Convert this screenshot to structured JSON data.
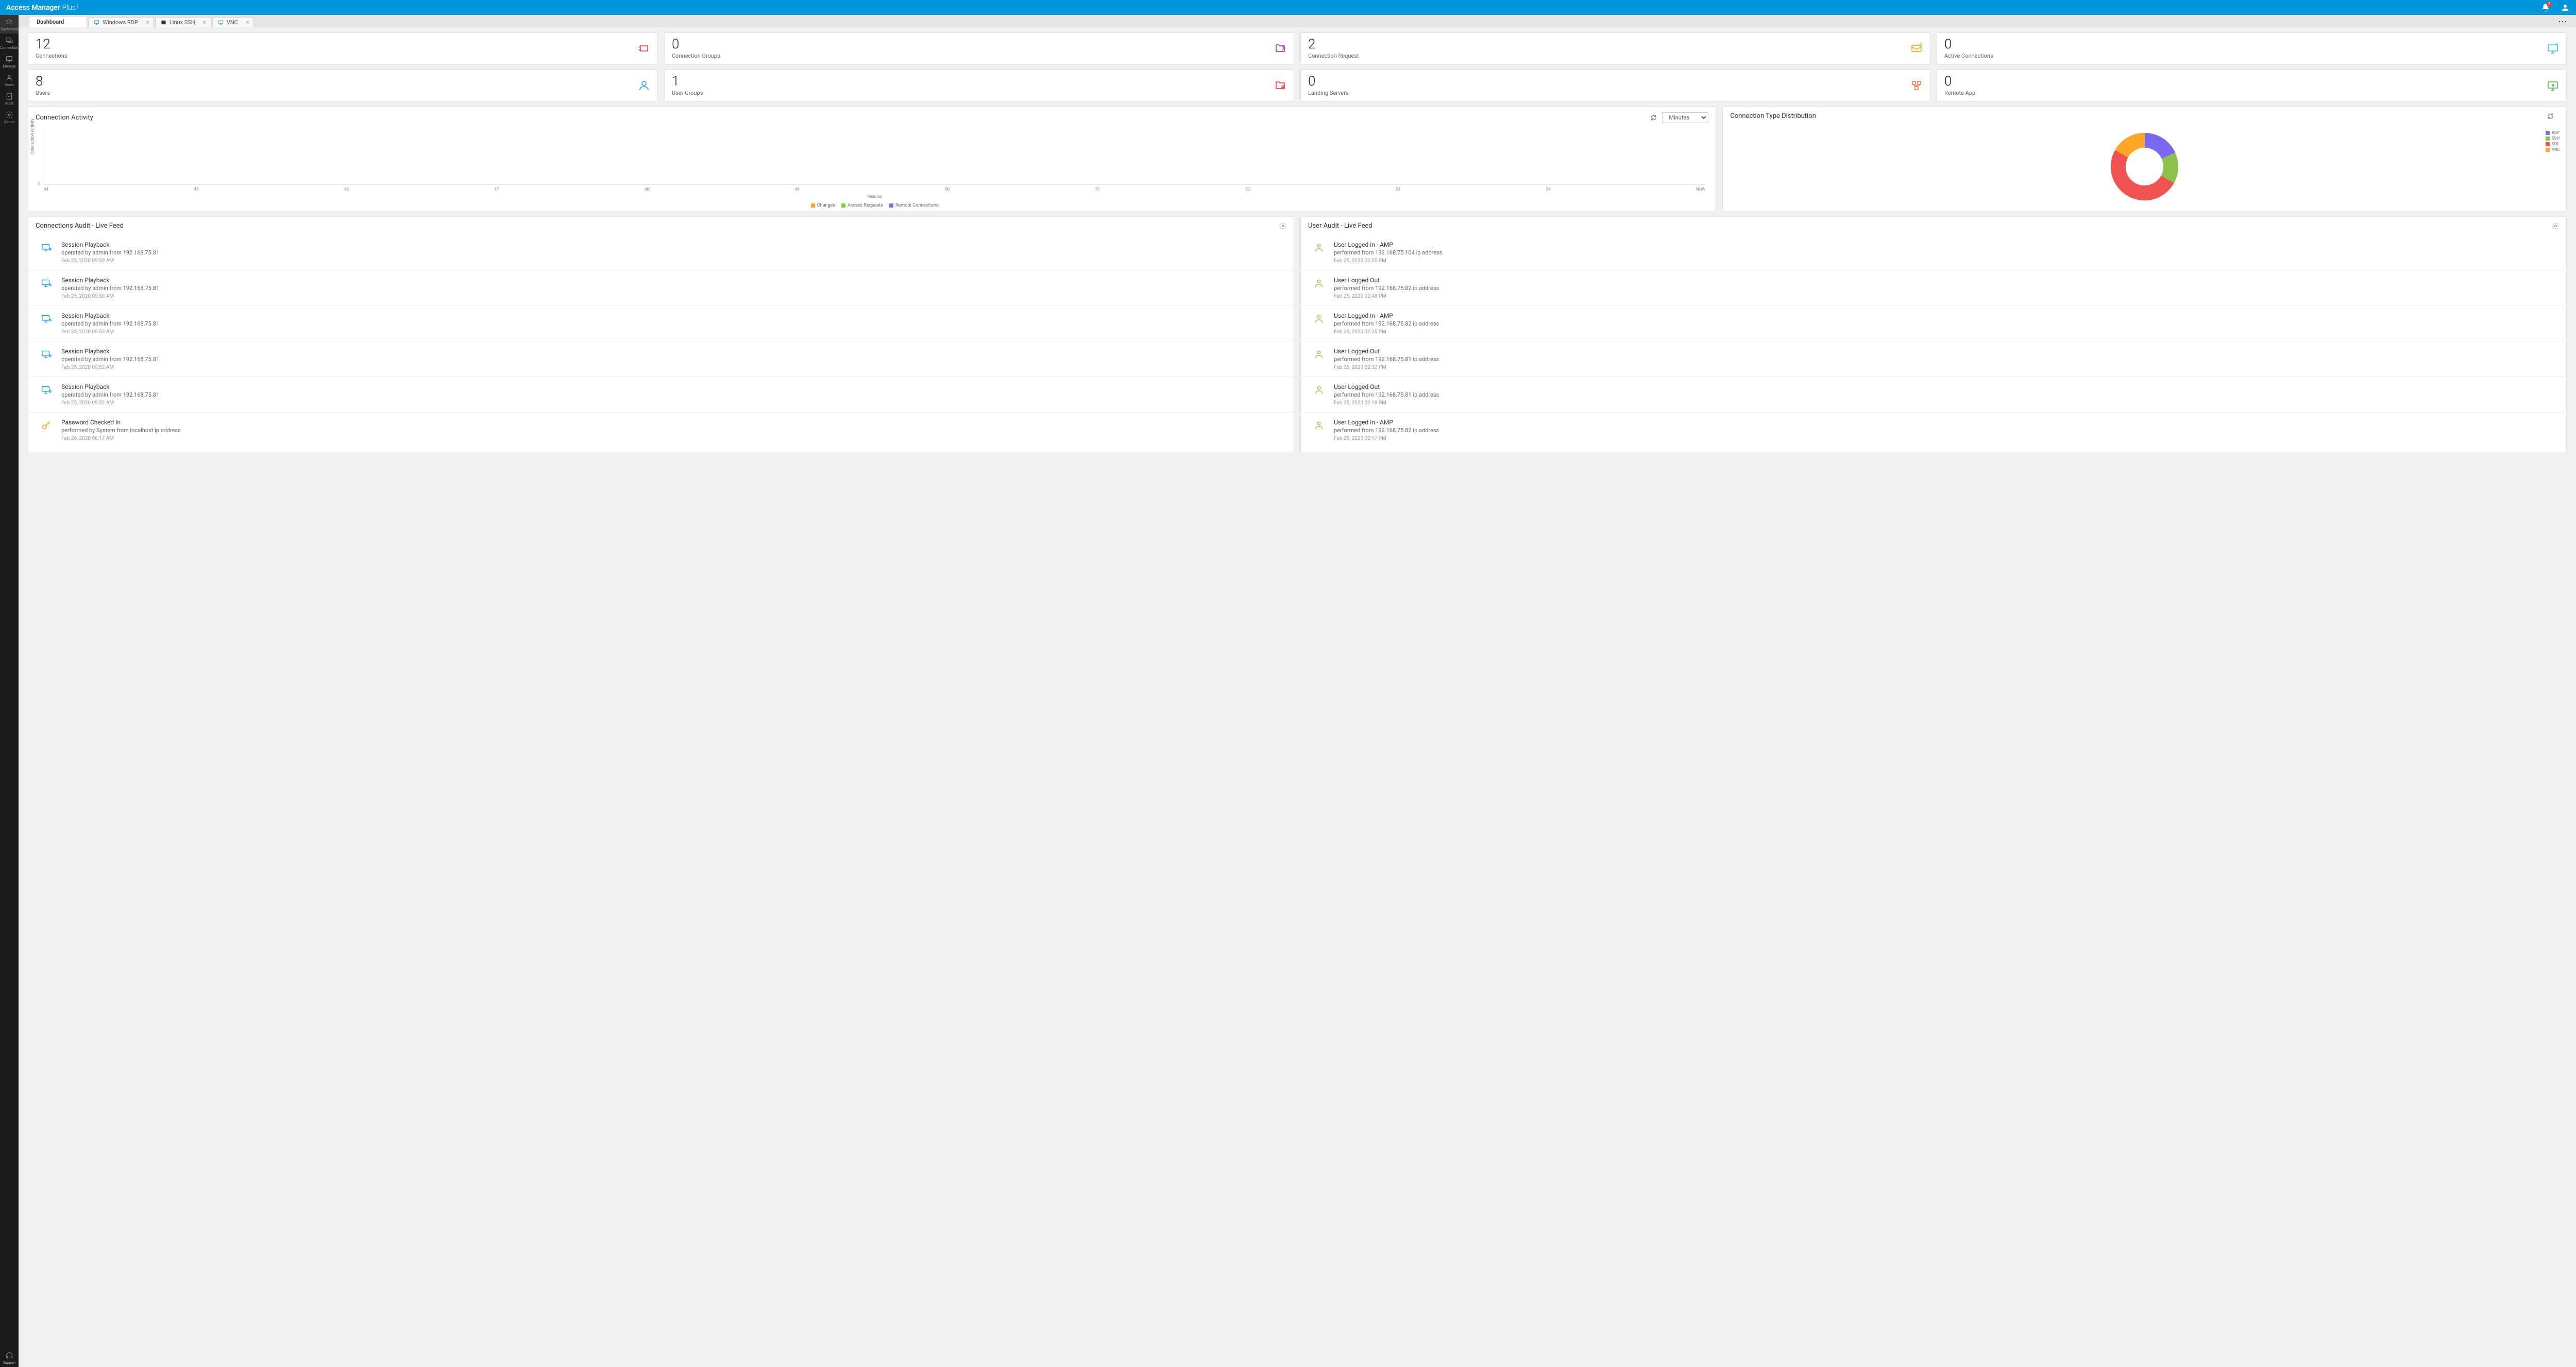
{
  "brand": {
    "main": "Access Manager",
    "sub": "Plus",
    "sup": ")"
  },
  "notif": "2",
  "sidebar": [
    {
      "label": "Dashboard",
      "on": true
    },
    {
      "label": "Connections"
    },
    {
      "label": "Manage"
    },
    {
      "label": "Users"
    },
    {
      "label": "Audit"
    },
    {
      "label": "Admin"
    }
  ],
  "sidebar_bottom": {
    "label": "Support"
  },
  "tabs": [
    {
      "label": "Dashboard",
      "on": true
    },
    {
      "label": "Windows RDP"
    },
    {
      "label": "Linux SSH"
    },
    {
      "label": "VNC"
    }
  ],
  "cards": [
    {
      "value": "12",
      "label": "Connections",
      "color": "#e53935"
    },
    {
      "value": "0",
      "label": "Connection Groups",
      "color": "#9c27b0"
    },
    {
      "value": "2",
      "label": "Connection Request",
      "color": "#ff9800"
    },
    {
      "value": "0",
      "label": "Active Connections",
      "color": "#26c6da"
    },
    {
      "value": "8",
      "label": "Users",
      "color": "#2196f3"
    },
    {
      "value": "1",
      "label": "User Groups",
      "color": "#e53935"
    },
    {
      "value": "0",
      "label": "Landing Servers",
      "color": "#ff7043"
    },
    {
      "value": "0",
      "label": "Remote App",
      "color": "#4caf50"
    }
  ],
  "activity": {
    "title": "Connection Activity",
    "select": "Minutes",
    "ylabel": "Connection Activity",
    "xlabel": "Minutes",
    "y0": "0",
    "xticks": [
      "44",
      "45",
      "46",
      "47",
      "48",
      "49",
      "50",
      "51",
      "52",
      "53",
      "54",
      "NOW"
    ],
    "legend": [
      "Changes",
      "Access Requests",
      "Remote Connections"
    ]
  },
  "dist": {
    "title": "Connection Type Distribution",
    "legend": [
      {
        "label": "RDP",
        "color": "#7b68ee"
      },
      {
        "label": "SSH",
        "color": "#8bc34a"
      },
      {
        "label": "SQL",
        "color": "#ef5350"
      },
      {
        "label": "VNC",
        "color": "#ffa726"
      }
    ]
  },
  "conn_audit": {
    "title": "Connections Audit - Live Feed",
    "items": [
      {
        "title": "Session Playback",
        "desc": "operated by admin from 192.168.75.81",
        "date": "Feb 25, 2020 09:59 AM",
        "icon": "monitor"
      },
      {
        "title": "Session Playback",
        "desc": "operated by admin from 192.168.75.81",
        "date": "Feb 25, 2020 09:58 AM",
        "icon": "monitor"
      },
      {
        "title": "Session Playback",
        "desc": "operated by admin from 192.168.75.81",
        "date": "Feb 25, 2020 09:53 AM",
        "icon": "monitor"
      },
      {
        "title": "Session Playback",
        "desc": "operated by admin from 192.168.75.81",
        "date": "Feb 25, 2020 09:52 AM",
        "icon": "monitor"
      },
      {
        "title": "Session Playback",
        "desc": "operated by admin from 192.168.75.81",
        "date": "Feb 25, 2020 09:52 AM",
        "icon": "monitor"
      },
      {
        "title": "Password Checked In",
        "desc": "performed by System from localhost ip address",
        "date": "Feb 26, 2020 06:17 AM",
        "icon": "key"
      }
    ]
  },
  "user_audit": {
    "title": "User Audit - Live Feed",
    "items": [
      {
        "title": "User Logged in - AMP",
        "desc": "performed from 192.168.75.104 ip address",
        "date": "Feb 25, 2020 02:55 PM"
      },
      {
        "title": "User Logged Out",
        "desc": "performed from 192.168.75.82 ip address",
        "date": "Feb 25, 2020 02:48 PM"
      },
      {
        "title": "User Logged in - AMP",
        "desc": "performed from 192.168.75.82 ip address",
        "date": "Feb 25, 2020 02:35 PM"
      },
      {
        "title": "User Logged Out",
        "desc": "performed from 192.168.75.81 ip address",
        "date": "Feb 25, 2020 02:32 PM"
      },
      {
        "title": "User Logged Out",
        "desc": "performed from 192.168.75.81 ip address",
        "date": "Feb 25, 2020 02:18 PM"
      },
      {
        "title": "User Logged in - AMP",
        "desc": "performed from 192.168.75.82 ip address",
        "date": "Feb 25, 2020 02:17 PM"
      }
    ]
  },
  "chart_data": {
    "type": "donut",
    "title": "Connection Type Distribution",
    "series": [
      {
        "name": "RDP",
        "value": 18,
        "color": "#7b68ee"
      },
      {
        "name": "SSH",
        "value": 15,
        "color": "#8bc34a"
      },
      {
        "name": "SQL",
        "value": 50,
        "color": "#ef5350"
      },
      {
        "name": "VNC",
        "value": 17,
        "color": "#ffa726"
      }
    ]
  }
}
